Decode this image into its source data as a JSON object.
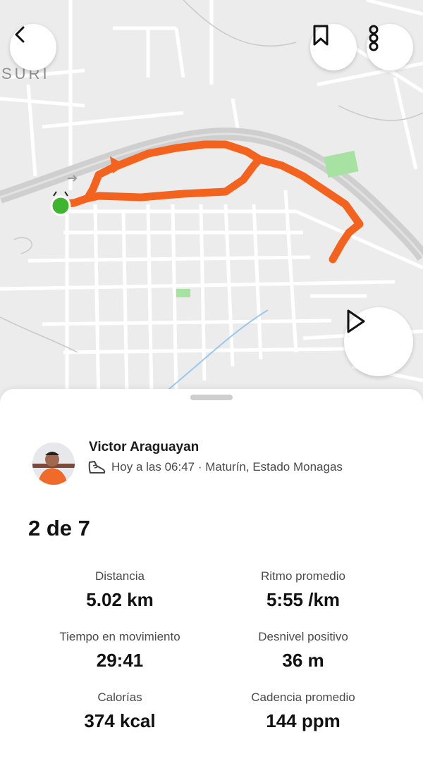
{
  "map": {
    "district_label": "SURI",
    "route_color": "#f4631e",
    "start_marker_color": "#3fb52f",
    "road_color": "#d2d2d2",
    "park_color": "#a7e2a2"
  },
  "toolbar": {
    "back_icon": "chevron-left-icon",
    "bookmark_icon": "bookmark-icon",
    "more_icon": "more-vertical-icon",
    "play_icon": "play-icon"
  },
  "athlete": {
    "name": "Victor Araguayan",
    "activity_icon": "shoe-icon",
    "meta": "Hoy a las 06:47 · Maturín, Estado Monagas"
  },
  "activity": {
    "title": "2 de 7"
  },
  "stats": [
    {
      "label": "Distancia",
      "value": "5.02 km"
    },
    {
      "label": "Ritmo promedio",
      "value": "5:55 /km"
    },
    {
      "label": "Tiempo en movimiento",
      "value": "29:41"
    },
    {
      "label": "Desnivel positivo",
      "value": "36 m"
    },
    {
      "label": "Calorías",
      "value": "374 kcal"
    },
    {
      "label": "Cadencia promedio",
      "value": "144 ppm"
    }
  ]
}
